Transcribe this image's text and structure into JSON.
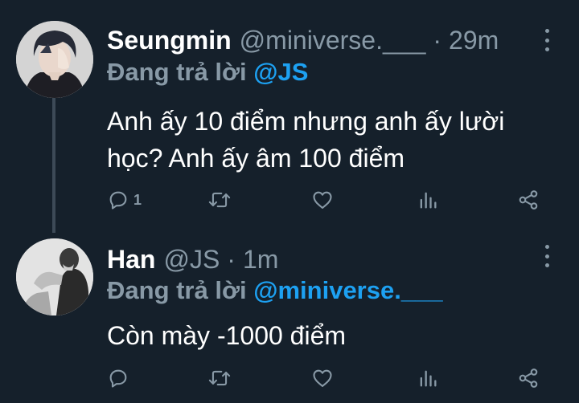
{
  "tweets": [
    {
      "name": "Seungmin",
      "handle": "@miniverse.___",
      "separator": "·",
      "time": "29m",
      "replying_label": "Đang trả lời",
      "replying_to": "@JS",
      "text": "Anh ấy 10 điểm nhưng anh ấy lười học? Anh ấy âm 100 điểm",
      "reply_count": "1",
      "avatar_icon": "user-avatar"
    },
    {
      "name": "Han",
      "handle": "@JS",
      "separator": "·",
      "time": "1m",
      "replying_label": "Đang trả lời",
      "replying_to": "@miniverse.___",
      "text": "Còn mày -1000 điểm",
      "reply_count": "",
      "avatar_icon": "user-avatar"
    }
  ],
  "colors": {
    "background": "#15202b",
    "text": "#ffffff",
    "secondary": "#8899a6",
    "accent": "#1da1f2"
  },
  "icons": [
    "reply-icon",
    "retweet-icon",
    "like-icon",
    "stats-icon",
    "share-icon",
    "more-icon"
  ]
}
